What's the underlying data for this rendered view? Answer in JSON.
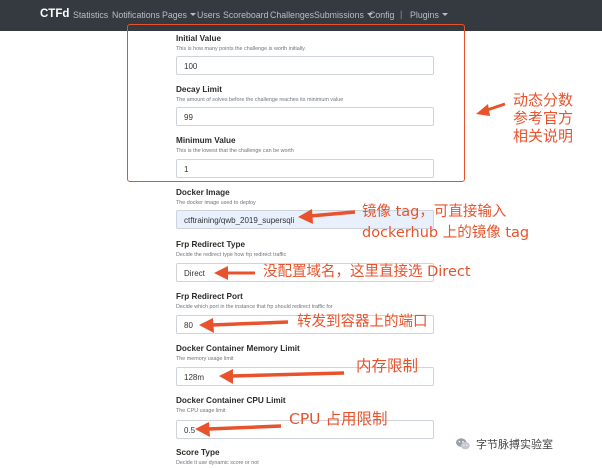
{
  "navbar": {
    "brand": "CTFd",
    "items": [
      {
        "label": "Statistics"
      },
      {
        "label": "Notifications"
      },
      {
        "label": "Pages"
      },
      {
        "label": "Users"
      },
      {
        "label": "Scoreboard"
      },
      {
        "label": "Challenges"
      },
      {
        "label": "Submissions"
      },
      {
        "label": "Config"
      },
      {
        "label": "Plugins"
      }
    ],
    "separator": "|"
  },
  "form": {
    "initial_value": {
      "label": "Initial Value",
      "help": "This is how many points the challenge is worth initially.",
      "value": "100"
    },
    "decay_limit": {
      "label": "Decay Limit",
      "help": "The amount of solves before the challenge reaches its minimum value",
      "value": "99"
    },
    "minimum_value": {
      "label": "Minimum Value",
      "help": "This is the lowest that the challenge can be worth",
      "value": "1"
    },
    "docker_image": {
      "label": "Docker Image",
      "help": "The docker image used to deploy",
      "value": "ctftraining/qwb_2019_supersqli"
    },
    "frp_redirect_type": {
      "label": "Frp Redirect Type",
      "help": "Decide the redirect type how frp redirect traffic",
      "value": "Direct"
    },
    "frp_redirect_port": {
      "label": "Frp Redirect Port",
      "help": "Decide which port in the instance that frp should redirect traffic for",
      "value": "80"
    },
    "memory_limit": {
      "label": "Docker Container Memory Limit",
      "help": "The memory usage limit",
      "value": "128m"
    },
    "cpu_limit": {
      "label": "Docker Container CPU Limit",
      "help": "The CPU usage limit",
      "value": "0.5"
    },
    "score_type": {
      "label": "Score Type",
      "help": "Decide it use dynamic score or not"
    }
  },
  "annotations": {
    "dynamic_score": [
      "动态分数",
      "参考官方",
      "相关说明"
    ],
    "docker_image": [
      "镜像 tag，可直接输入",
      "dockerhub 上的镜像 tag"
    ],
    "redirect_type": "没配置域名，这里直接选 Direct",
    "redirect_port": "转发到容器上的端口",
    "memory": "内存限制",
    "cpu": "CPU 占用限制"
  },
  "watermark": {
    "text": "字节脉搏实验室",
    "icon": "wechat-icon"
  },
  "colors": {
    "navbar": "#343a40",
    "annotation": "#e8532c",
    "autofill": "#e8f0fe"
  }
}
